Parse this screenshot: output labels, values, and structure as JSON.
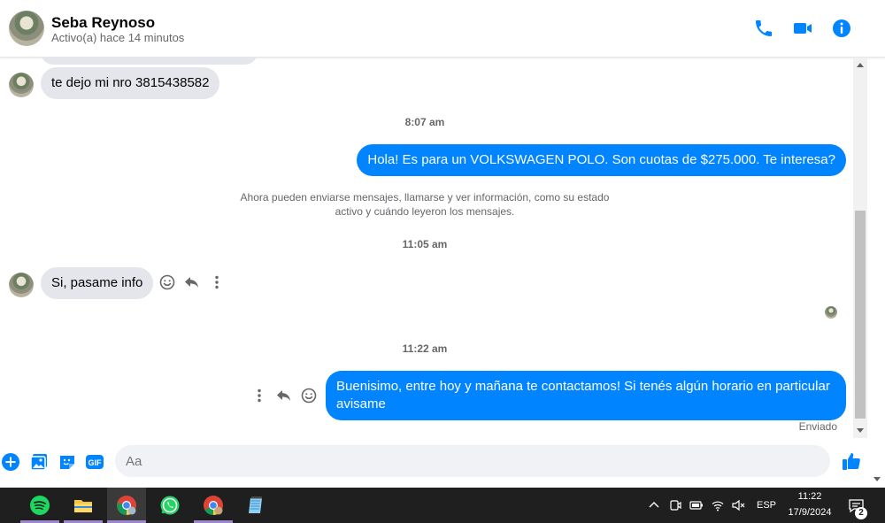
{
  "header": {
    "name": "Seba Reynoso",
    "status": "Activo(a) hace 14 minutos",
    "icons": [
      "phone-icon",
      "video-camera-icon",
      "info-icon"
    ],
    "accent": "#0084ff"
  },
  "messages": {
    "incoming_1": "te dejo mi nro 3815438582",
    "ts_1": "8:07 am",
    "outgoing_1": "Hola! Es para un VOLKSWAGEN POLO. Son cuotas de $275.000. Te interesa?",
    "system_1": "Ahora pueden enviarse mensajes, llamarse y ver información, como su estado activo y cuándo leyeron los mensajes.",
    "ts_2": "11:05 am",
    "incoming_2": "Si, pasame info",
    "ts_3": "11:22 am",
    "outgoing_2": "Buenisimo, entre hoy y mañana te contactamos! Si tenés algún horario en particular avisame",
    "sent_status": "Enviado"
  },
  "composer": {
    "placeholder": "Aa",
    "icons": [
      "plus-icon",
      "photo-icon",
      "sticker-icon",
      "gif-icon",
      "emoji-icon",
      "thumbs-up-icon"
    ],
    "gif_label": "GIF"
  },
  "taskbar": {
    "apps": [
      "spotify-icon",
      "file-explorer-icon",
      "chrome-icon",
      "whatsapp-icon",
      "chrome-icon",
      "notepad-icon"
    ],
    "language": "ESP",
    "time": "11:22",
    "date": "17/9/2024",
    "notification_count": "2"
  }
}
